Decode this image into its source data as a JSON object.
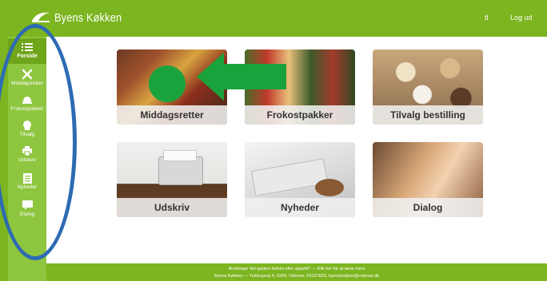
{
  "header": {
    "app_title": "Byens Køkken",
    "user_initials": "tl",
    "logout_label": "Log ud"
  },
  "sidebar": {
    "items": [
      {
        "label": "Forside",
        "icon": "list-icon"
      },
      {
        "label": "Middagsretter",
        "icon": "cutlery-icon"
      },
      {
        "label": "Frokostpakker",
        "icon": "cloche-icon"
      },
      {
        "label": "Tilvalg",
        "icon": "cupcake-icon"
      },
      {
        "label": "Udskriv",
        "icon": "printer-icon"
      },
      {
        "label": "Nyheder",
        "icon": "newspaper-icon"
      },
      {
        "label": "Dialog",
        "icon": "chat-icon"
      }
    ]
  },
  "tiles": [
    {
      "label": "Middagsretter"
    },
    {
      "label": "Frokostpakker"
    },
    {
      "label": "Tilvalg bestilling"
    },
    {
      "label": "Udskriv"
    },
    {
      "label": "Nyheder"
    },
    {
      "label": "Dialog"
    }
  ],
  "footer": {
    "line1": "Ændringer fen-gutters behov eller appetit? — Klik her for at læse mere",
    "line2": "Byens Køkken — Tolstrupvej 4, 5260, Odense, 63157820, byenskokken@odense.dk"
  },
  "colors": {
    "brand_green": "#7cb51f",
    "sidebar_green": "#8ec63f",
    "annotation_blue": "#2d6bb3",
    "annotation_green": "#1aa33c"
  }
}
